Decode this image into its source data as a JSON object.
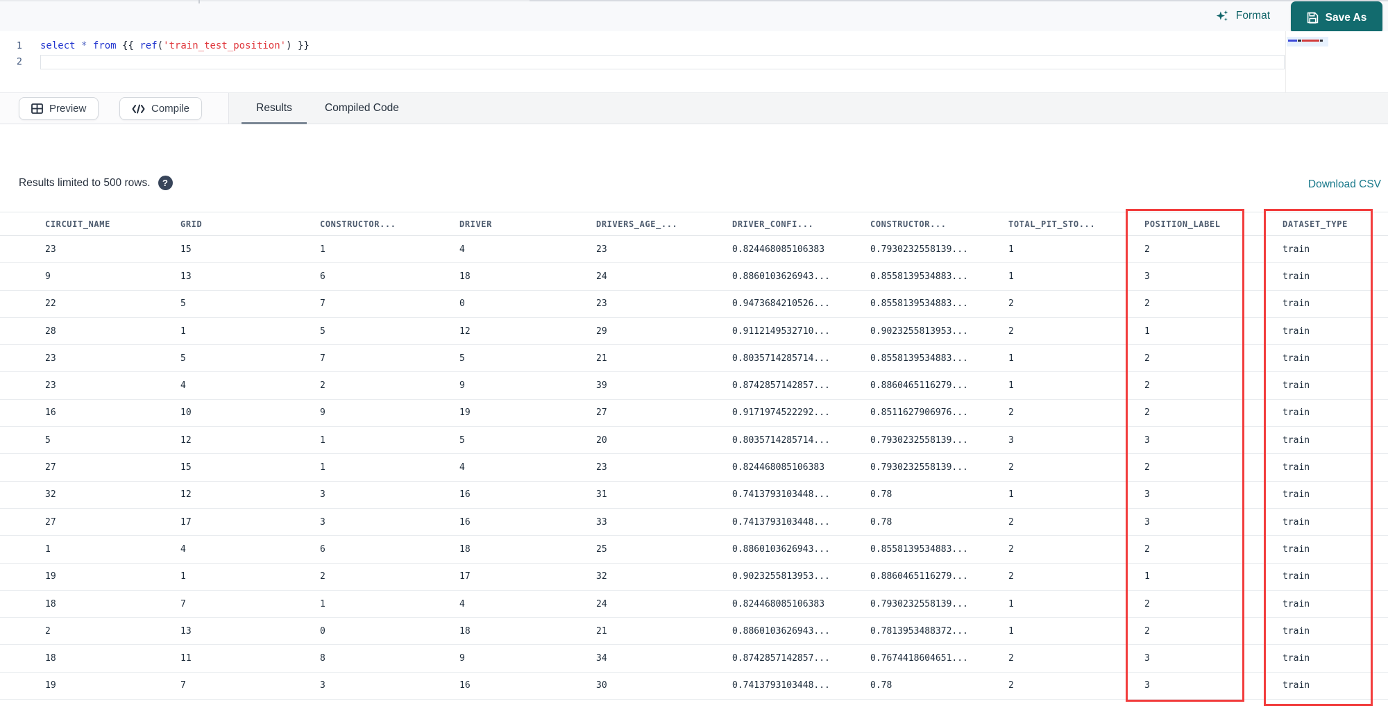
{
  "topbar": {
    "format_label": "Format",
    "save_as_label": "Save As"
  },
  "editor": {
    "line_numbers": [
      "1",
      "2"
    ],
    "code_tokens": [
      {
        "text": "select",
        "cls": "kw"
      },
      {
        "text": " ",
        "cls": "pl"
      },
      {
        "text": "*",
        "cls": "op"
      },
      {
        "text": " ",
        "cls": "pl"
      },
      {
        "text": "from",
        "cls": "kw"
      },
      {
        "text": " ",
        "cls": "pl"
      },
      {
        "text": "{{",
        "cls": "br"
      },
      {
        "text": " ",
        "cls": "pl"
      },
      {
        "text": "ref",
        "cls": "fn"
      },
      {
        "text": "(",
        "cls": "br"
      },
      {
        "text": "'train_test_position'",
        "cls": "str"
      },
      {
        "text": ")",
        "cls": "br"
      },
      {
        "text": " ",
        "cls": "pl"
      },
      {
        "text": "}}",
        "cls": "br"
      }
    ]
  },
  "actions": {
    "preview_label": "Preview",
    "compile_label": "Compile"
  },
  "tabs": [
    {
      "label": "Results",
      "active": true
    },
    {
      "label": "Compiled Code",
      "active": false
    }
  ],
  "results_bar": {
    "info_text": "Results limited to 500 rows.",
    "help_glyph": "?",
    "download_link": "Download CSV"
  },
  "table": {
    "headers": [
      "CIRCUIT_NAME",
      "GRID",
      "CONSTRUCTOR...",
      "DRIVER",
      "DRIVERS_AGE_...",
      "DRIVER_CONFI...",
      "CONSTRUCTOR...",
      "TOTAL_PIT_STO...",
      "POSITION_LABEL",
      "DATASET_TYPE"
    ],
    "rows": [
      [
        "23",
        "15",
        "1",
        "4",
        "23",
        "0.824468085106383",
        "0.7930232558139...",
        "1",
        "2",
        "train"
      ],
      [
        "9",
        "13",
        "6",
        "18",
        "24",
        "0.8860103626943...",
        "0.8558139534883...",
        "1",
        "3",
        "train"
      ],
      [
        "22",
        "5",
        "7",
        "0",
        "23",
        "0.9473684210526...",
        "0.8558139534883...",
        "2",
        "2",
        "train"
      ],
      [
        "28",
        "1",
        "5",
        "12",
        "29",
        "0.9112149532710...",
        "0.9023255813953...",
        "2",
        "1",
        "train"
      ],
      [
        "23",
        "5",
        "7",
        "5",
        "21",
        "0.8035714285714...",
        "0.8558139534883...",
        "1",
        "2",
        "train"
      ],
      [
        "23",
        "4",
        "2",
        "9",
        "39",
        "0.8742857142857...",
        "0.8860465116279...",
        "1",
        "2",
        "train"
      ],
      [
        "16",
        "10",
        "9",
        "19",
        "27",
        "0.9171974522292...",
        "0.8511627906976...",
        "2",
        "2",
        "train"
      ],
      [
        "5",
        "12",
        "1",
        "5",
        "20",
        "0.8035714285714...",
        "0.7930232558139...",
        "3",
        "3",
        "train"
      ],
      [
        "27",
        "15",
        "1",
        "4",
        "23",
        "0.824468085106383",
        "0.7930232558139...",
        "2",
        "2",
        "train"
      ],
      [
        "32",
        "12",
        "3",
        "16",
        "31",
        "0.7413793103448...",
        "0.78",
        "1",
        "3",
        "train"
      ],
      [
        "27",
        "17",
        "3",
        "16",
        "33",
        "0.7413793103448...",
        "0.78",
        "2",
        "3",
        "train"
      ],
      [
        "1",
        "4",
        "6",
        "18",
        "25",
        "0.8860103626943...",
        "0.8558139534883...",
        "2",
        "2",
        "train"
      ],
      [
        "19",
        "1",
        "2",
        "17",
        "32",
        "0.9023255813953...",
        "0.8860465116279...",
        "2",
        "1",
        "train"
      ],
      [
        "18",
        "7",
        "1",
        "4",
        "24",
        "0.824468085106383",
        "0.7930232558139...",
        "1",
        "2",
        "train"
      ],
      [
        "2",
        "13",
        "0",
        "18",
        "21",
        "0.8860103626943...",
        "0.7813953488372...",
        "1",
        "2",
        "train"
      ],
      [
        "18",
        "11",
        "8",
        "9",
        "34",
        "0.8742857142857...",
        "0.7674418604651...",
        "2",
        "3",
        "train"
      ],
      [
        "19",
        "7",
        "3",
        "16",
        "30",
        "0.7413793103448...",
        "0.78",
        "2",
        "3",
        "train"
      ]
    ]
  },
  "annotations": {
    "boxed_columns": [
      "POSITION_LABEL",
      "DATASET_TYPE"
    ]
  },
  "colors": {
    "accent_teal": "#126b6e",
    "link_teal": "#17788a",
    "annotation_red": "#f23d3d"
  }
}
